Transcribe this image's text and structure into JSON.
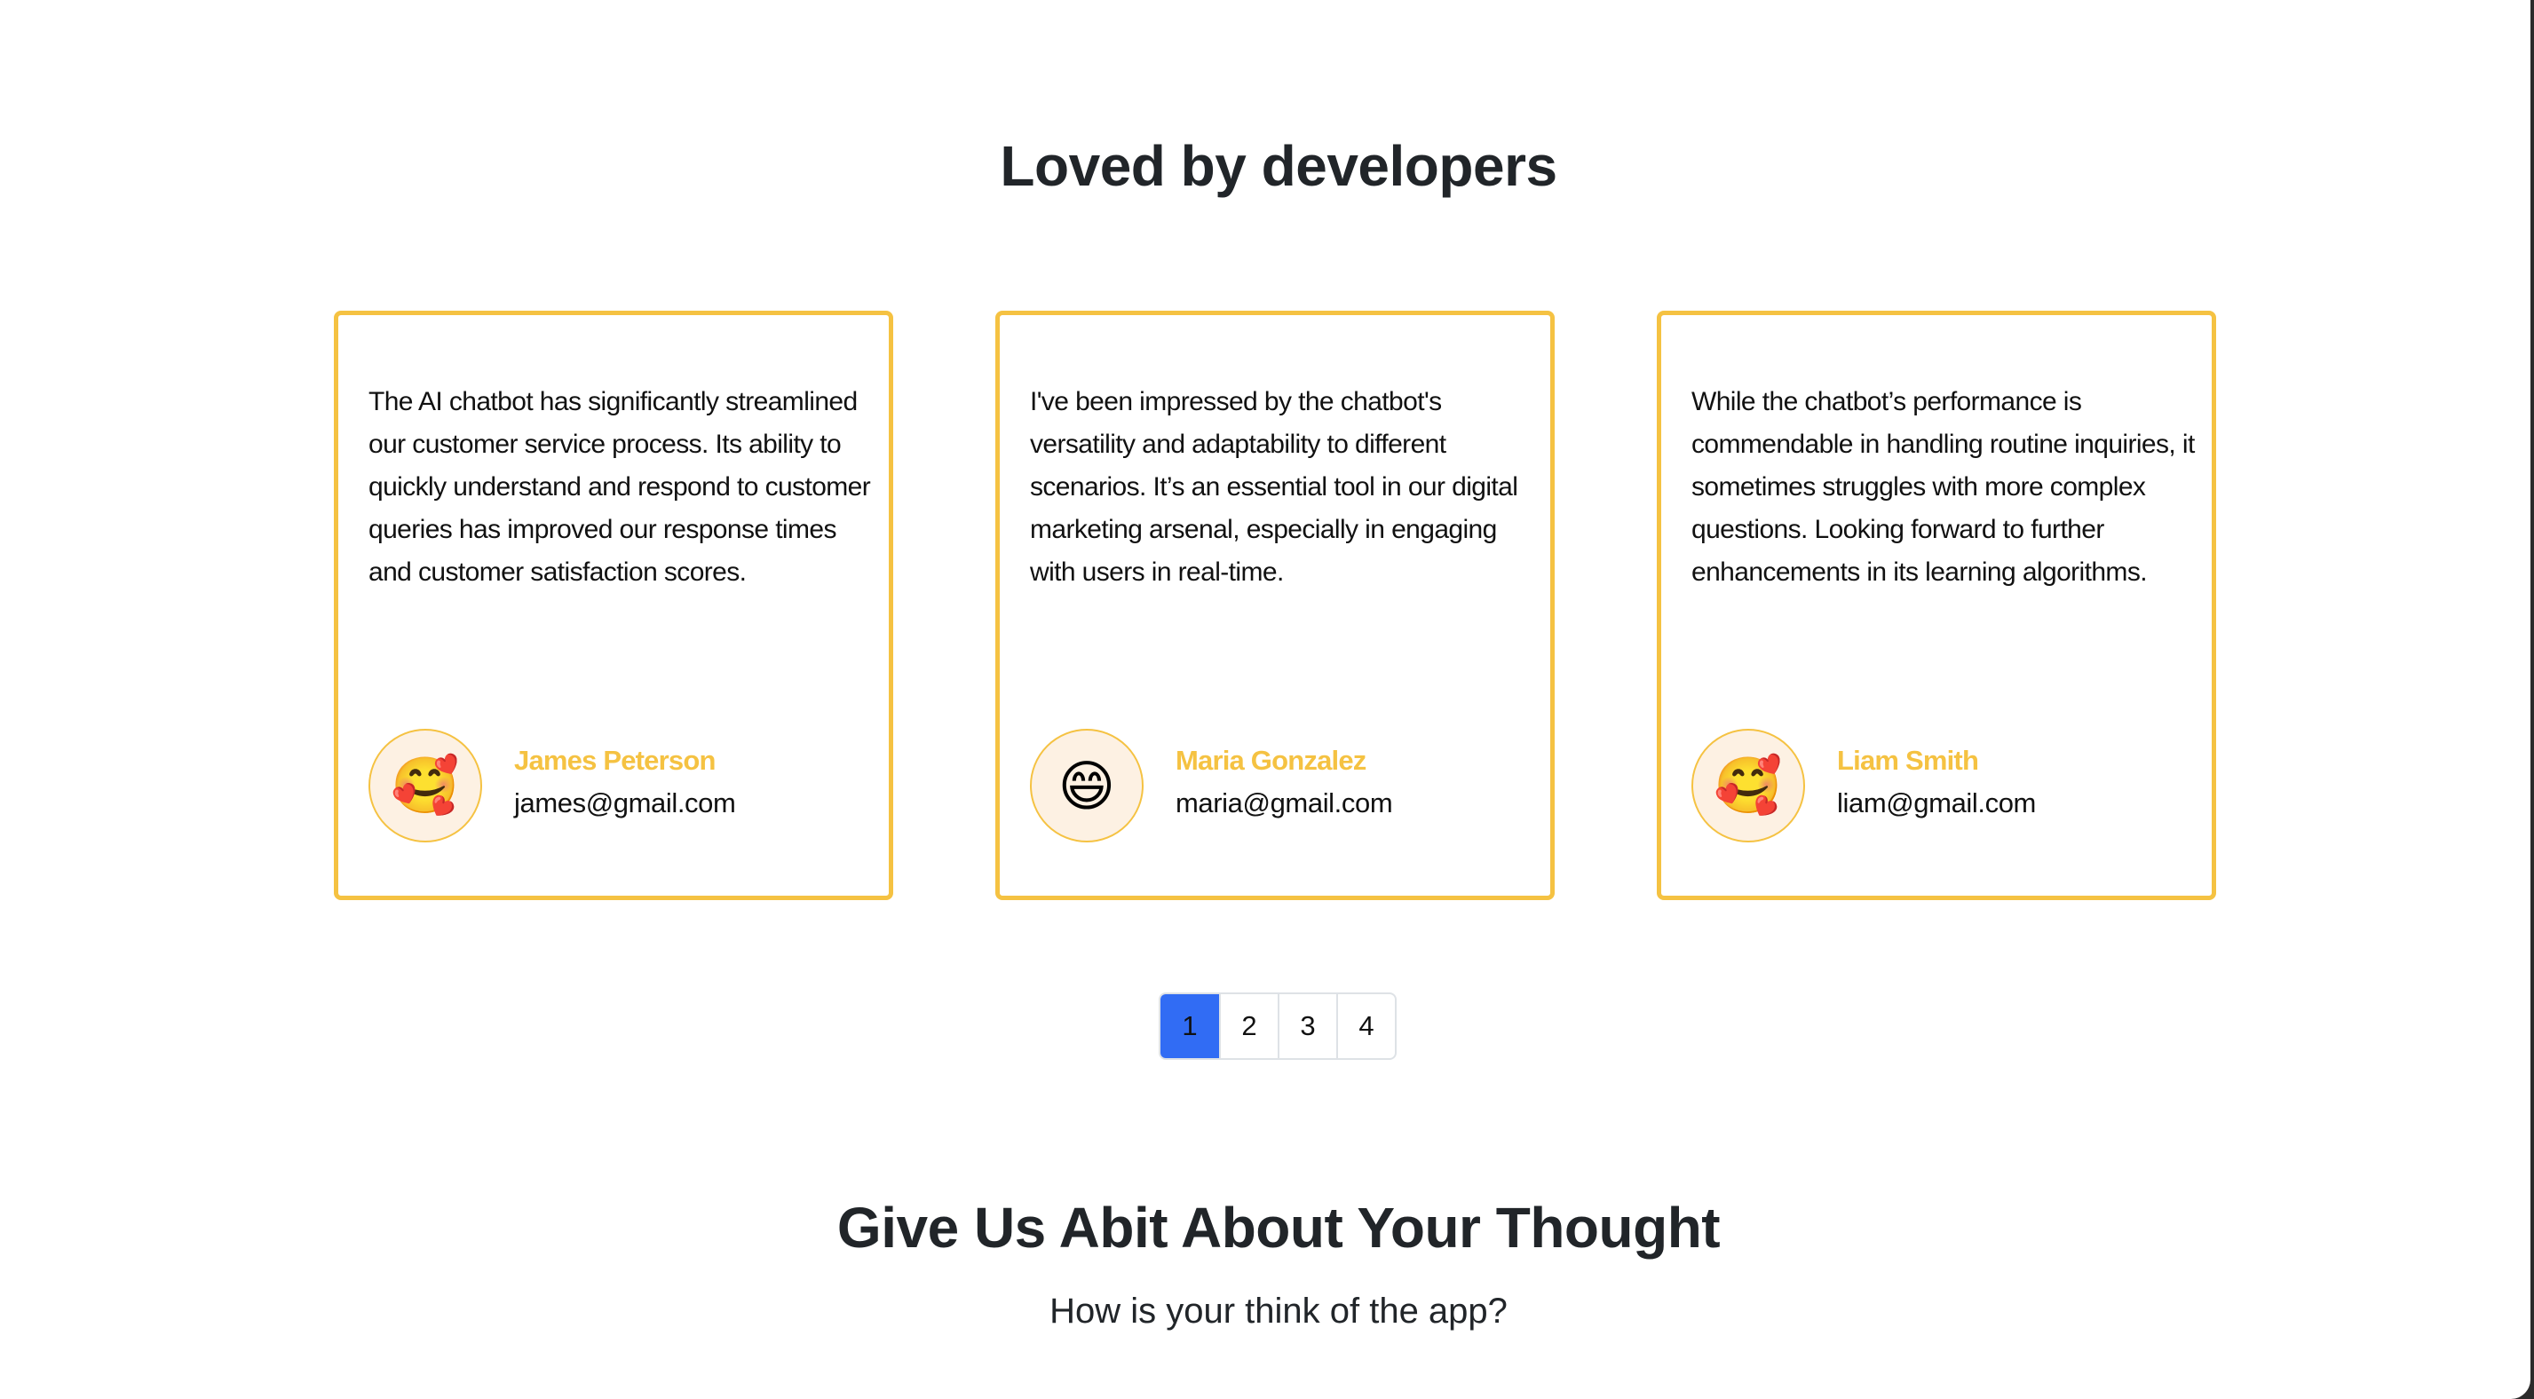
{
  "testimonials": {
    "title": "Loved by developers",
    "items": [
      {
        "text": "The AI chatbot has significantly streamlined our customer service process. Its ability to quickly understand and respond to customer queries has improved our response times and customer satisfaction scores.",
        "avatar_emoji": "🥰",
        "avatar_icon": "smiling-face-with-hearts-icon",
        "name": "James Peterson",
        "email": "james@gmail.com"
      },
      {
        "text": "I've been impressed by the chatbot's versatility and adaptability to different scenarios. It’s an essential tool in our digital marketing arsenal, especially in engaging with users in real-time.",
        "avatar_emoji": "😄",
        "avatar_icon": "grinning-face-icon",
        "name": "Maria Gonzalez",
        "email": "maria@gmail.com"
      },
      {
        "text": "While the chatbot’s performance is commendable in handling routine inquiries, it sometimes struggles with more complex questions. Looking forward to further enhancements in its learning algorithms.",
        "avatar_emoji": "🥰",
        "avatar_icon": "smiling-face-with-hearts-icon",
        "name": "Liam Smith",
        "email": "liam@gmail.com"
      }
    ]
  },
  "pagination": {
    "pages": [
      "1",
      "2",
      "3",
      "4"
    ],
    "current": "1"
  },
  "feedback": {
    "title": "Give Us Abit About Your Thought",
    "subtitle": "How is your think of the app?"
  },
  "colors": {
    "card_border": "#f5c242",
    "author_name": "#f5c242",
    "avatar_bg": "#fdf1e3",
    "pagination_active": "#316cf4",
    "heading": "#212529"
  }
}
